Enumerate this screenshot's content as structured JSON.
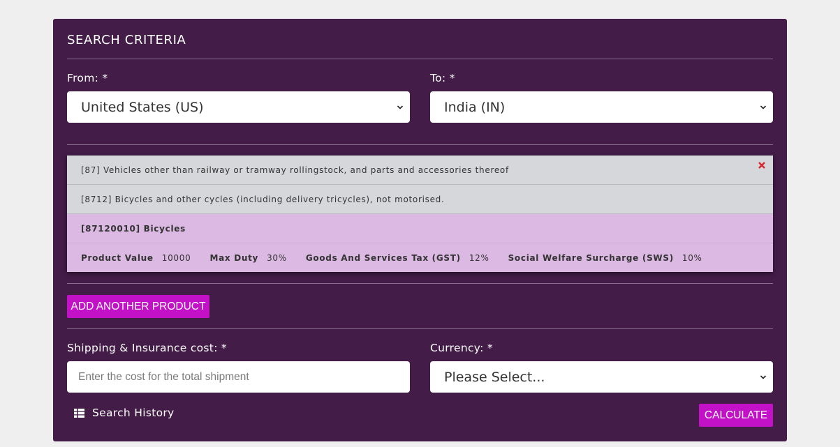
{
  "search": {
    "title": "SEARCH CRITERIA",
    "from_label": "From: *",
    "from_value": "United States (US)",
    "to_label": "To: *",
    "to_value": "India (IN)"
  },
  "product": {
    "chapter": "[87] Vehicles other than railway or tramway rollingstock, and parts and accessories thereof",
    "heading": "[8712] Bicycles and other cycles (including delivery tricycles), not motorised.",
    "item": "[87120010] Bicycles",
    "details": [
      {
        "key": "Product Value",
        "value": "10000"
      },
      {
        "key": "Max Duty",
        "value": "30%"
      },
      {
        "key": "Goods And Services Tax (GST)",
        "value": "12%"
      },
      {
        "key": "Social Welfare Surcharge (SWS)",
        "value": "10%"
      }
    ],
    "remove_icon": "close-x-icon"
  },
  "actions": {
    "add_product": "ADD ANOTHER PRODUCT",
    "calculate": "CALCULATE",
    "search_history": "Search History"
  },
  "shipping": {
    "label": "Shipping & Insurance cost: *",
    "placeholder": "Enter the cost for the total shipment",
    "value": ""
  },
  "currency": {
    "label": "Currency: *",
    "value": "Please Select..."
  },
  "colors": {
    "panel": "#431c48",
    "accent": "#c211c7",
    "row_gray": "#d6d7db",
    "row_pink": "#dbb9e2",
    "close_red": "#d9262b"
  }
}
